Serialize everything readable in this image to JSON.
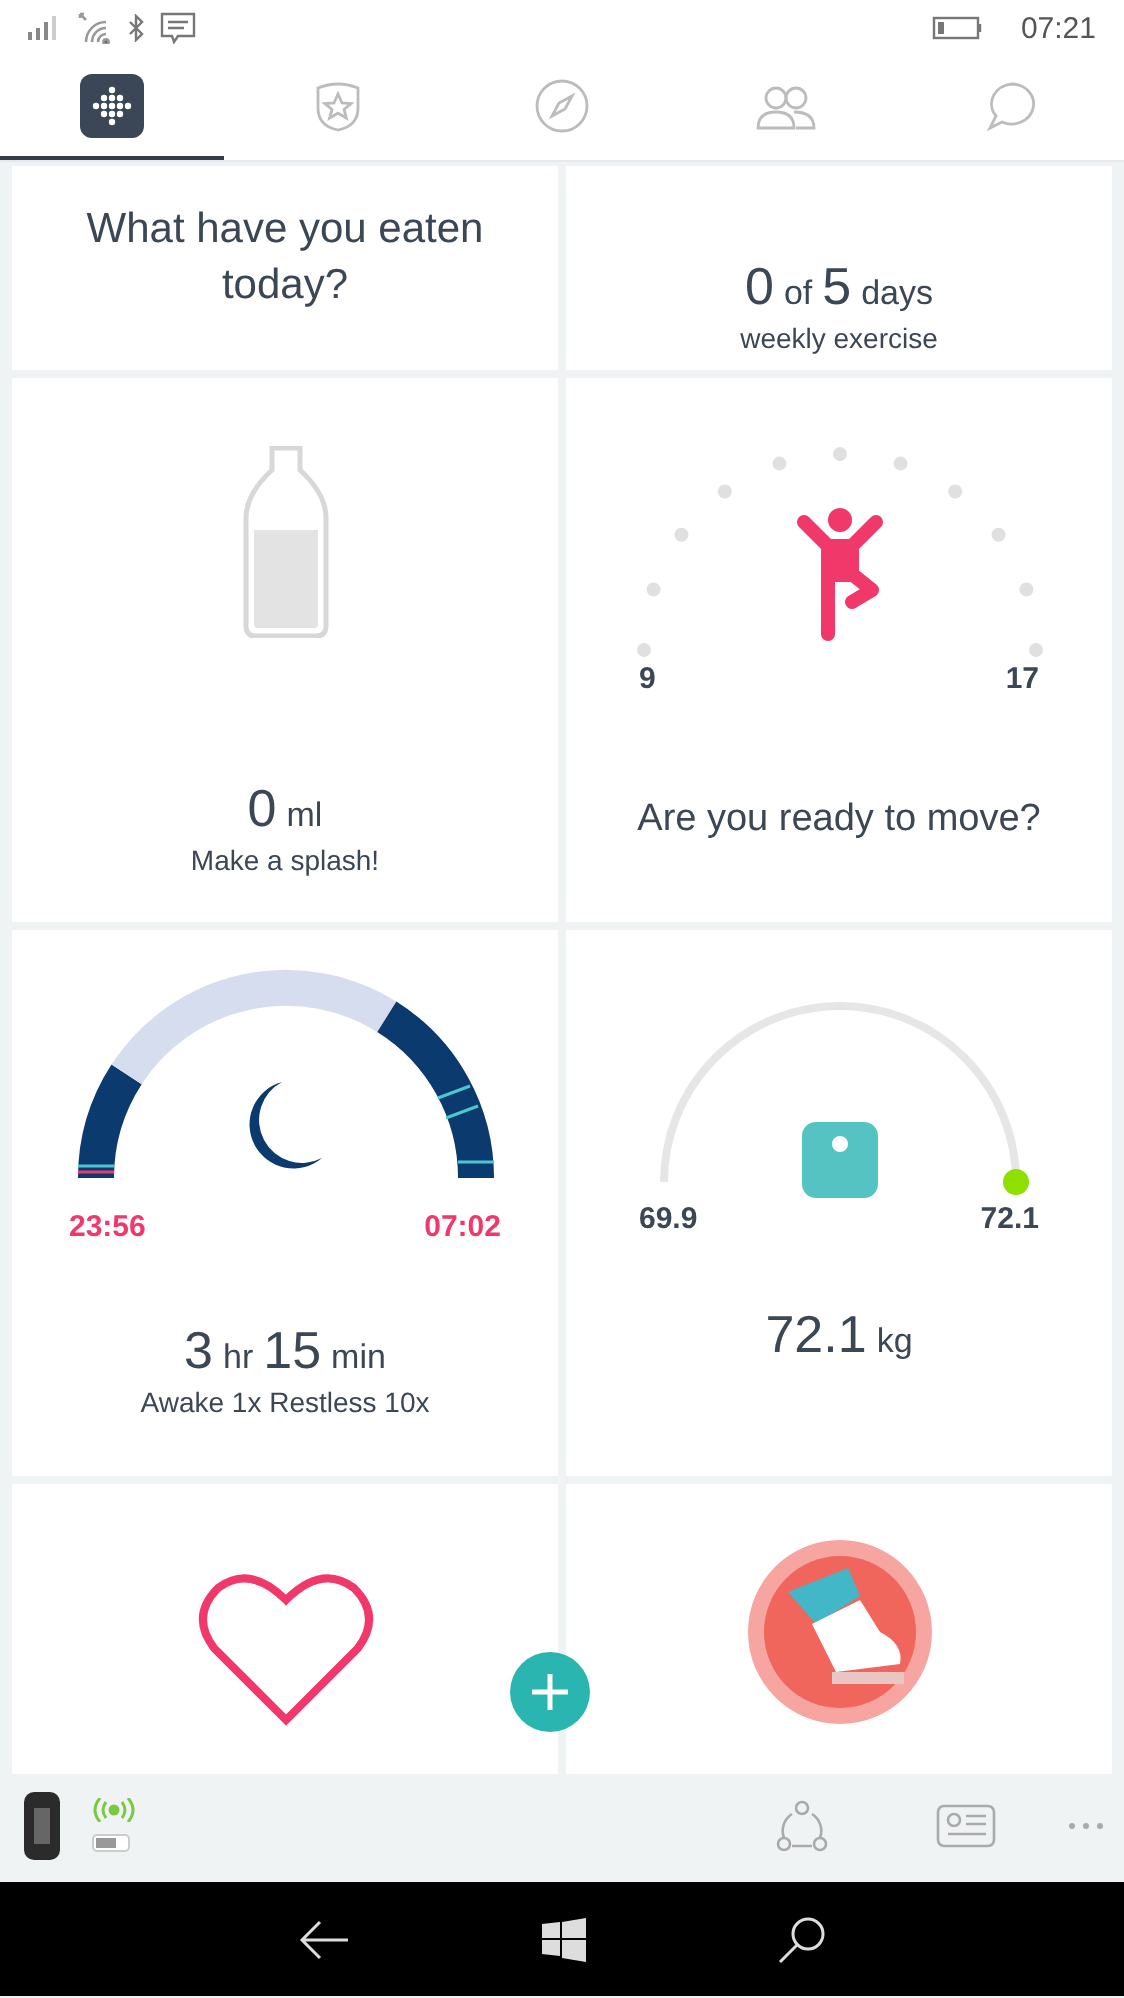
{
  "status_bar": {
    "time": "07:21"
  },
  "tabs": [
    {
      "kind": "dashboard",
      "selected": true
    },
    {
      "kind": "challenges",
      "selected": false
    },
    {
      "kind": "discover",
      "selected": false
    },
    {
      "kind": "friends",
      "selected": false
    },
    {
      "kind": "messages",
      "selected": false
    }
  ],
  "tile_rows": [
    {
      "tiles": [
        {
          "kind": "food",
          "title": "What have you eaten today?"
        },
        {
          "kind": "exercise",
          "count": "0",
          "of": "of",
          "goal": "5",
          "unit": "days",
          "caption": "weekly exercise"
        }
      ]
    },
    {
      "tiles": [
        {
          "kind": "water",
          "amount": "0",
          "unit": "ml",
          "caption": "Make a splash!"
        },
        {
          "kind": "move",
          "start": "9",
          "end": "17",
          "caption": "Are you ready to move?"
        }
      ]
    },
    {
      "tiles": [
        {
          "kind": "sleep",
          "start": "23:56",
          "end": "07:02",
          "hours": "3",
          "hours_unit": "hr",
          "minutes": "15",
          "minutes_unit": "min",
          "caption": "Awake 1x Restless 10x"
        },
        {
          "kind": "weight",
          "min": "69.9",
          "max": "72.1",
          "value": "72.1",
          "unit": "kg"
        }
      ]
    },
    {
      "tiles": [
        {
          "kind": "heart"
        },
        {
          "kind": "badge"
        }
      ]
    }
  ]
}
